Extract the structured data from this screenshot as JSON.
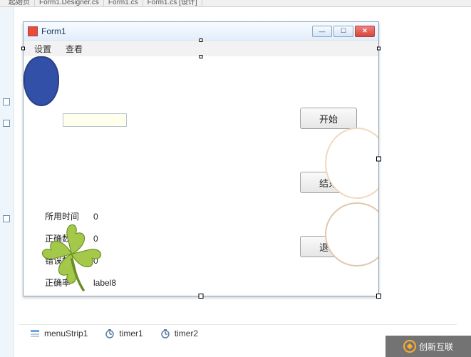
{
  "ide_tabs": [
    "起始页",
    "Form1.Designer.cs",
    "Form1.cs",
    "Form1.cs [设计]"
  ],
  "window": {
    "title": "Form1"
  },
  "menu": {
    "item1": "设置",
    "item2": "查看"
  },
  "buttons": {
    "start": "开始",
    "stop": "结束",
    "exit": "退出"
  },
  "labels": {
    "time_used": "所用时间",
    "correct_count": "正确数",
    "wrong_count": "错误数",
    "accuracy": "正确率"
  },
  "values": {
    "time_used": "0",
    "correct_count": "0",
    "wrong_count": "0",
    "accuracy": "label8"
  },
  "tray": {
    "menustrip": "menuStrip1",
    "timer1": "timer1",
    "timer2": "timer2"
  },
  "watermark": "创新互联"
}
